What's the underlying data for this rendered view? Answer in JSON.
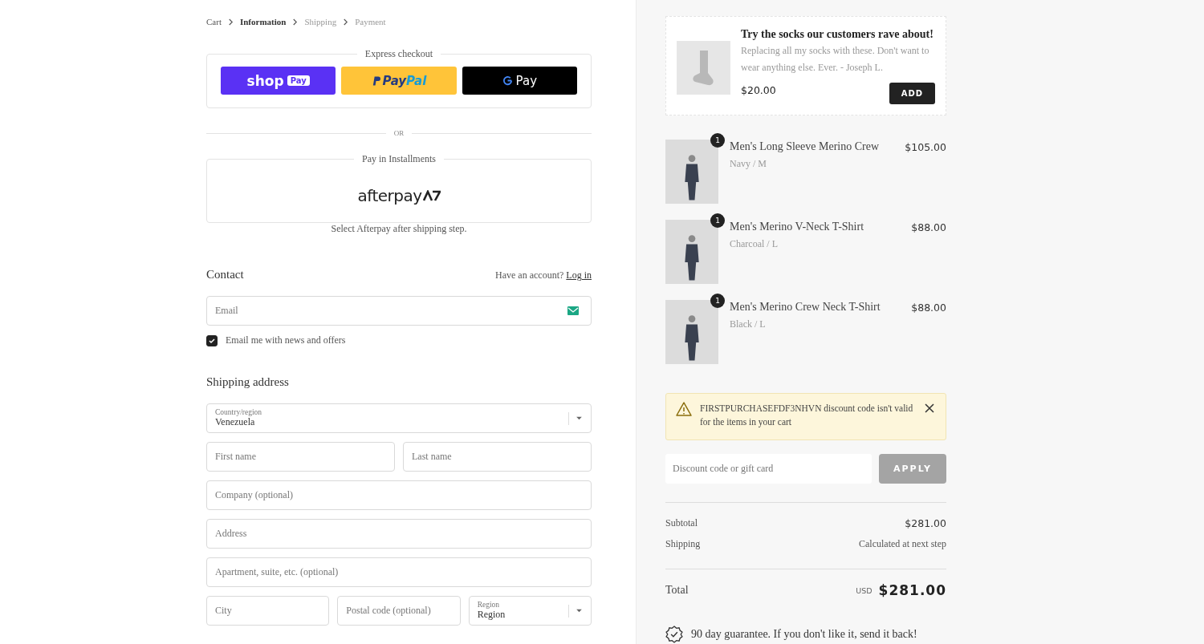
{
  "breadcrumb": [
    {
      "label": "Cart",
      "selected": false,
      "disabled": false
    },
    {
      "label": "Information",
      "selected": true,
      "disabled": false
    },
    {
      "label": "Shipping",
      "selected": false,
      "disabled": true
    },
    {
      "label": "Payment",
      "selected": false,
      "disabled": true
    }
  ],
  "express_checkout": {
    "title": "Express checkout",
    "buttons": [
      {
        "kind": "shop",
        "text": "shop",
        "badge": "Pay"
      },
      {
        "kind": "paypal",
        "text": "Pay",
        "text2": "Pal"
      },
      {
        "kind": "gpay",
        "text": "Pay"
      }
    ]
  },
  "divider": "OR",
  "installments": {
    "title": "Pay in Installments",
    "logo": "afterpay",
    "note": "Select Afterpay after shipping step."
  },
  "contact": {
    "title": "Contact",
    "account_prompt": "Have an account?",
    "login_link": "Log in",
    "email_placeholder": "Email",
    "newsletter": {
      "label": "Email me with news and offers",
      "checked": true
    }
  },
  "shipping_address": {
    "title": "Shipping address",
    "rows": [
      [
        {
          "kind": "select",
          "label": "Country/region",
          "value": "Venezuela"
        }
      ],
      [
        {
          "kind": "text",
          "placeholder": "First name"
        },
        {
          "kind": "text",
          "placeholder": "Last name"
        }
      ],
      [
        {
          "kind": "text",
          "placeholder": "Company (optional)"
        }
      ],
      [
        {
          "kind": "text",
          "placeholder": "Address"
        }
      ],
      [
        {
          "kind": "text",
          "placeholder": "Apartment, suite, etc. (optional)"
        }
      ],
      [
        {
          "kind": "text",
          "placeholder": "City"
        },
        {
          "kind": "text",
          "placeholder": "Postal code (optional)"
        },
        {
          "kind": "select",
          "label": "Region",
          "value": "Region"
        }
      ]
    ]
  },
  "upsell": {
    "title": "Try the socks our customers rave about!",
    "quote": "Replacing all my socks with these. Don't want to wear anything else. Ever. - Joseph L.",
    "price": "$20.00",
    "button": "ADD"
  },
  "cart_items": [
    {
      "name": "Men's Long Sleeve Merino Crew",
      "variant": "Navy / M",
      "quantity": "1",
      "price": "$105.00"
    },
    {
      "name": "Men's Merino V-Neck T-Shirt",
      "variant": "Charcoal / L",
      "quantity": "1",
      "price": "$88.00"
    },
    {
      "name": "Men's Merino Crew Neck T-Shirt",
      "variant": "Black / L",
      "quantity": "1",
      "price": "$88.00"
    }
  ],
  "alert": {
    "message": "FIRSTPURCHASEFDF3NHVN discount code isn't valid for the items in your cart"
  },
  "discount": {
    "placeholder": "Discount code or gift card",
    "button": "APPLY",
    "disabled": true
  },
  "summary": {
    "subtotal_label": "Subtotal",
    "subtotal": "$281.00",
    "shipping_label": "Shipping",
    "shipping": "Calculated at next step",
    "total_label": "Total",
    "currency": "USD",
    "total": "$281.00"
  },
  "guarantee": "90 day guarantee. If you don't like it, send it back!"
}
